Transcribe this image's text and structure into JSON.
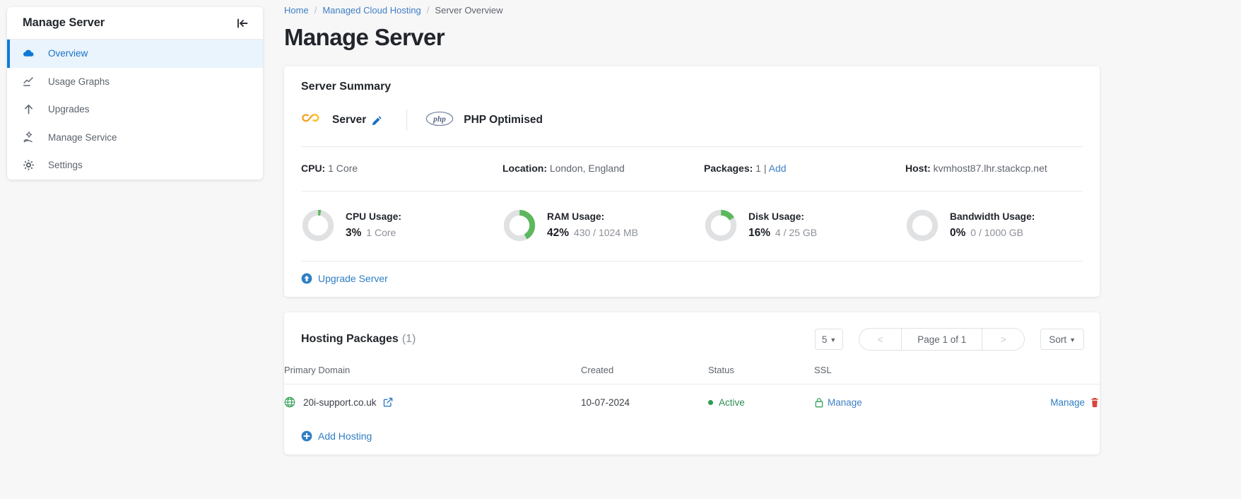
{
  "sidebar": {
    "title": "Manage Server",
    "collapse_icon": "collapse-left-icon",
    "items": [
      {
        "label": "Overview",
        "icon": "cloud-icon",
        "active": true
      },
      {
        "label": "Usage Graphs",
        "icon": "chart-line-icon",
        "active": false
      },
      {
        "label": "Upgrades",
        "icon": "arrow-up-icon",
        "active": false
      },
      {
        "label": "Manage Service",
        "icon": "hand-gear-icon",
        "active": false
      },
      {
        "label": "Settings",
        "icon": "gear-icon",
        "active": false
      }
    ]
  },
  "breadcrumb": {
    "items": [
      "Home",
      "Managed Cloud Hosting",
      "Server Overview"
    ],
    "separator": "/"
  },
  "page_title": "Manage Server",
  "server_summary": {
    "heading": "Server Summary",
    "badges": [
      {
        "icon": "server-cloud-logo-icon",
        "label": "Server",
        "edit_icon": "pencil-icon"
      },
      {
        "icon": "php-logo-icon",
        "label": "PHP Optimised"
      }
    ],
    "info": [
      {
        "label": "CPU:",
        "value": "1 Core"
      },
      {
        "label": "Location:",
        "value": "London, England"
      },
      {
        "label": "Packages:",
        "value": "1",
        "sep": "|",
        "link": "Add"
      },
      {
        "label": "Host:",
        "value": "kvmhost87.lhr.stackcp.net"
      }
    ],
    "gauges": [
      {
        "label": "CPU Usage:",
        "percent": 3,
        "percent_text": "3%",
        "detail": "1 Core"
      },
      {
        "label": "RAM Usage:",
        "percent": 42,
        "percent_text": "42%",
        "detail": "430 / 1024 MB"
      },
      {
        "label": "Disk Usage:",
        "percent": 16,
        "percent_text": "16%",
        "detail": "4 / 25 GB"
      },
      {
        "label": "Bandwidth Usage:",
        "percent": 0,
        "percent_text": "0%",
        "detail": "0 / 1000 GB"
      }
    ],
    "upgrade_link": "Upgrade Server",
    "upgrade_icon": "arrow-up-circle-icon"
  },
  "hosting_packages": {
    "heading": "Hosting Packages",
    "count": "(1)",
    "per_page": "5",
    "pager": {
      "prev": "<",
      "page_label": "Page 1 of 1",
      "next": ">"
    },
    "sort_label": "Sort",
    "columns": [
      "Primary Domain",
      "Created",
      "Status",
      "SSL",
      ""
    ],
    "rows": [
      {
        "domain": "20i-support.co.uk",
        "domain_icon": "globe-icon",
        "external_icon": "external-link-icon",
        "created": "10-07-2024",
        "status": "Active",
        "ssl": "Manage",
        "ssl_icon": "lock-icon",
        "action": "Manage",
        "action_icon": "trash-icon"
      }
    ],
    "add_link": "Add Hosting",
    "add_icon": "plus-circle-icon"
  },
  "colors": {
    "accent_blue": "#2f7ec4",
    "gauge_green": "#5cb85c",
    "gauge_track": "#e0e1e2",
    "status_green": "#2a9d4f",
    "danger_red": "#d8453c",
    "logo_orange": "#f5a021",
    "active_nav_bg": "#eaf4fc"
  }
}
